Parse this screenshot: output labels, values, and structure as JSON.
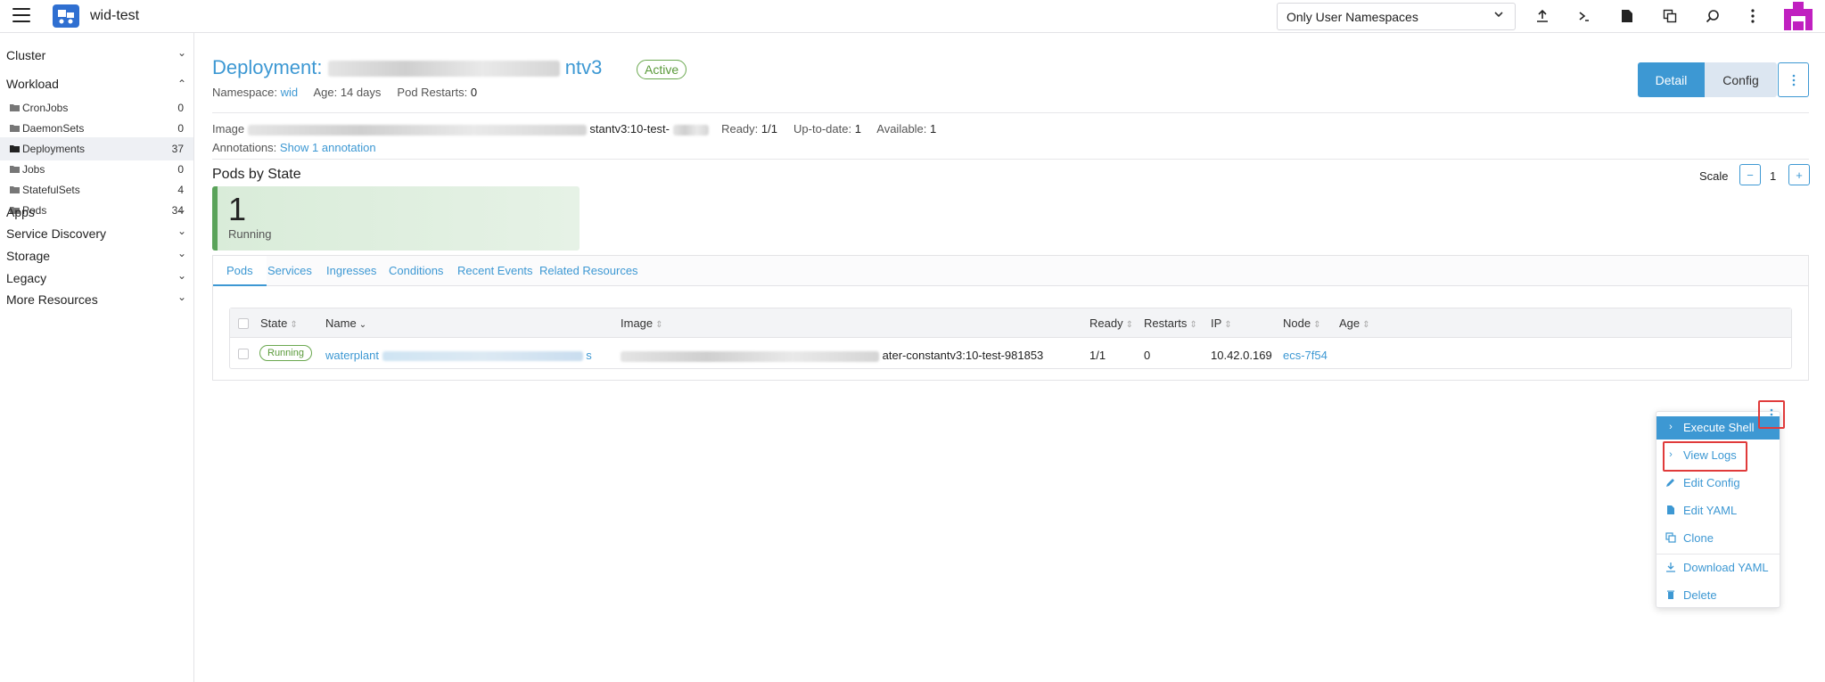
{
  "app": {
    "title": "wid-test"
  },
  "header": {
    "namespace_filter": "Only User Namespaces",
    "icons": [
      "upload-icon",
      "shell-icon",
      "file-icon",
      "copy-icon",
      "search-icon",
      "more-vertical-icon"
    ]
  },
  "sidebar": {
    "groups": [
      {
        "label": "Cluster",
        "expanded": false
      },
      {
        "label": "Workload",
        "expanded": true
      },
      {
        "label": "Apps",
        "expanded": false
      },
      {
        "label": "Service Discovery",
        "expanded": false
      },
      {
        "label": "Storage",
        "expanded": false
      },
      {
        "label": "Legacy",
        "expanded": false
      },
      {
        "label": "More Resources",
        "expanded": false
      }
    ],
    "items": [
      {
        "label": "CronJobs",
        "count": "0"
      },
      {
        "label": "DaemonSets",
        "count": "0"
      },
      {
        "label": "Deployments",
        "count": "37"
      },
      {
        "label": "Jobs",
        "count": "0"
      },
      {
        "label": "StatefulSets",
        "count": "4"
      },
      {
        "label": "Pods",
        "count": "34"
      }
    ]
  },
  "page": {
    "title_prefix": "Deployment:",
    "title_suffix": "ntv3",
    "status": "Active",
    "namespace_label": "Namespace:",
    "namespace": "wid",
    "age": "Age: 14 days",
    "restarts_label": "Pod Restarts:",
    "restarts": "0",
    "btn_detail": "Detail",
    "btn_config": "Config",
    "image_label": "Image",
    "image_suffix": "stantv3:10-test-",
    "ready": "Ready: ",
    "ready_val": "1/1",
    "uptodate": "Up-to-date: ",
    "uptodate_val": "1",
    "available": "Available: ",
    "available_val": "1",
    "annotations_label": "Annotations:",
    "annotations_link": "Show 1 annotation",
    "pods_by_state": "Pods by State",
    "scale_label": "Scale",
    "scale_value": "1",
    "state_count": "1",
    "state_label": "Running"
  },
  "tabs": [
    "Pods",
    "Services",
    "Ingresses",
    "Conditions",
    "Recent Events",
    "Related Resources"
  ],
  "table": {
    "headers": [
      "State",
      "Name",
      "Image",
      "Ready",
      "Restarts",
      "IP",
      "Node",
      "Age"
    ],
    "row": {
      "state": "Running",
      "name_prefix": "waterplant",
      "name_suffix": "s",
      "image_suffix": "ater-constantv3:10-test-981853",
      "ready": "1/1",
      "restarts": "0",
      "ip": "10.42.0.169",
      "node": "ecs-7f54"
    }
  },
  "menu": {
    "items": [
      {
        "label": "Execute Shell",
        "icon": "chevron-right-icon"
      },
      {
        "label": "View Logs",
        "icon": "chevron-right-icon"
      },
      {
        "label": "Edit Config",
        "icon": "pencil-icon"
      },
      {
        "label": "Edit YAML",
        "icon": "file-icon"
      },
      {
        "label": "Clone",
        "icon": "copy-icon"
      },
      {
        "label": "Download YAML",
        "icon": "download-icon"
      },
      {
        "label": "Delete",
        "icon": "trash-icon"
      }
    ]
  },
  "colors": {
    "accent": "#3d98d3",
    "active": "#5aa35a",
    "highlight_box": "#e03b3b"
  }
}
